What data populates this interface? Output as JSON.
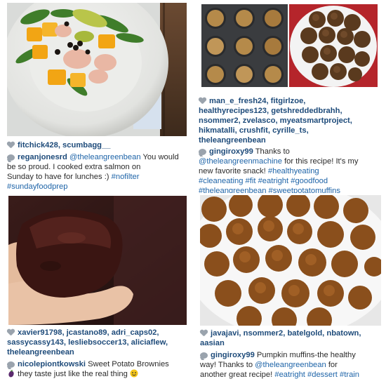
{
  "posts": [
    {
      "likers": "fitchick428, scumbagg__",
      "comment_user": "reganjonesrd",
      "comment_mention": "@theleangreenbean",
      "comment_text_1": " You would",
      "comment_text_2": "be so proud. I cooked extra salmon on",
      "comment_text_3": "Sunday to have for lunches :) ",
      "tag_1": "#nofilter",
      "tag_2": "#sundayfoodprep"
    },
    {
      "likers_1": "man_e_fresh24, fitgirlzoe,",
      "likers_2": "healthyrecipes123, getshreddedbrahh,",
      "likers_3": "nsommer2, zvelasco, myeatsmartproject,",
      "likers_4": "hikmatalli, crushfit, cyrille_ts,",
      "likers_5": "theleangreenbean",
      "comment_user": "gingiroxy99",
      "comment_text_1": " Thanks to",
      "comment_mention": "@theleangreenmachine",
      "comment_text_2": " for this recipe! It's my",
      "comment_text_3": "new favorite snack! ",
      "tag_1": "#healthyeating",
      "tag_2": "#cleaneating #fit #eatright #goodfood",
      "tag_3": "#theleangreenbean #sweetpotatomuffins"
    },
    {
      "likers_1": "xavier91798, jcastano89, adri_caps02,",
      "likers_2": "sassycassy143, lesliebsoccer13, aliciaflew,",
      "likers_3": "theleangreenbean",
      "comment_user": "nicolepiontkowski",
      "comment_text_1": " Sweet Potato Brownies",
      "comment_text_2": " they taste just like the real thing "
    },
    {
      "likers_1": "javajavi, nsommer2, batelgold, nbatown,",
      "likers_2": "aasian",
      "comment_user": "gingiroxy99",
      "comment_text_1": " Pumpkin muffins-the healthy",
      "comment_text_2": "way! Thanks to ",
      "comment_mention": "@theleangreenbean",
      "comment_text_3": " for",
      "comment_text_4": "another great recipe! ",
      "tag_1": "#eatright #dessert #train"
    }
  ],
  "colors": {
    "username": "#1e4b7a",
    "hashtag": "#1e64a8",
    "icon": "#9aa3ad"
  },
  "icons": [
    "heart-icon",
    "comment-bubble-icon"
  ]
}
